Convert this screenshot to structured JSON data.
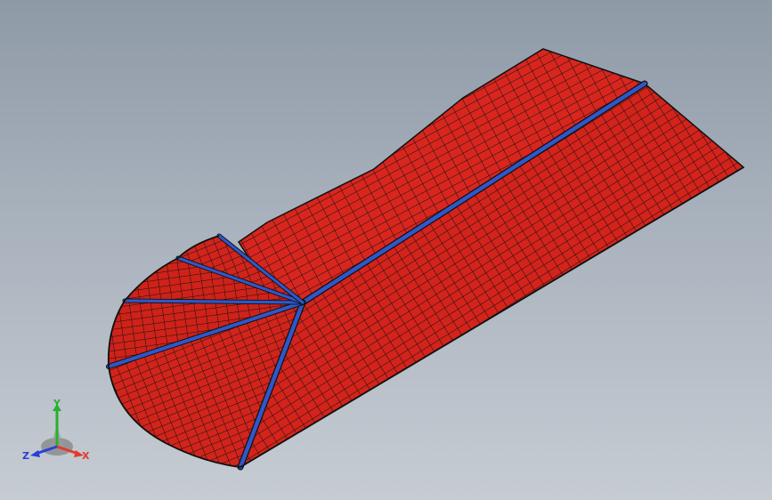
{
  "viewport": {
    "background_top": "#8f9aa7",
    "background_bottom": "#c6ccd3"
  },
  "model": {
    "name": "hip-roof-tiles",
    "tile_color": "#d8261e",
    "grid_color": "#111111",
    "ridge_color": "#2f57c9"
  },
  "triad": {
    "x_label": "X",
    "y_label": "Y",
    "z_label": "Z",
    "x_color": "#e23b2e",
    "y_color": "#27b12d",
    "z_color": "#2a3fd8"
  }
}
